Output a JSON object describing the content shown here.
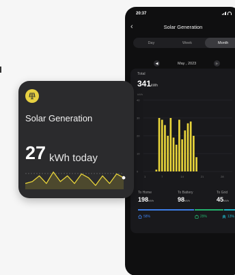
{
  "colors": {
    "accent": "#e8d43a",
    "blue": "#3d7ee8",
    "green": "#23b26d",
    "teal": "#21b6c9"
  },
  "phone": {
    "time": "20:37",
    "title": "Solar Generation",
    "back_icon": "chevron-left-icon",
    "tabs": [
      {
        "label": "Day",
        "active": false
      },
      {
        "label": "Week",
        "active": false
      },
      {
        "label": "Month",
        "active": true
      }
    ],
    "date": "May , 2023",
    "total_label": "Total",
    "total_value": "341",
    "total_unit": "kWh",
    "axis_unit": "kWh",
    "stats": [
      {
        "label": "To Home",
        "value": "198",
        "unit": "kWh"
      },
      {
        "label": "To Battery",
        "value": "98",
        "unit": "kWh"
      },
      {
        "label": "To Grid",
        "value": "45",
        "unit": "kWh"
      }
    ],
    "percents": [
      {
        "icon": "home-icon",
        "value": "58%"
      },
      {
        "icon": "battery-icon",
        "value": "29%"
      },
      {
        "icon": "grid-tower-icon",
        "value": "13%"
      }
    ]
  },
  "chart_data": {
    "type": "bar",
    "yticks": [
      "40",
      "30",
      "20",
      "10",
      "0"
    ],
    "xticks": [
      "1",
      "7",
      "14",
      "21",
      "28"
    ],
    "ylim": [
      0,
      40
    ],
    "x": [
      1,
      2,
      3,
      4,
      5,
      6,
      7,
      8,
      9,
      10,
      11,
      12,
      13,
      14,
      15,
      16,
      17,
      18,
      19,
      20,
      21,
      22,
      23,
      24,
      25,
      26,
      27,
      28,
      29,
      30,
      31
    ],
    "values": [
      0,
      0,
      0,
      0,
      1,
      30,
      29,
      26,
      20,
      30,
      19,
      15,
      29,
      18,
      23,
      27,
      28,
      20,
      8,
      0,
      0,
      0,
      0,
      0,
      0,
      0,
      0,
      0,
      0,
      0,
      0
    ],
    "series_color": "#e8d43a"
  },
  "widget": {
    "icon": "solar-panel-icon",
    "title": "Solar Generation",
    "value": "27",
    "unit": "kWh today",
    "sparkline": [
      3,
      4,
      7,
      3,
      9,
      4,
      7,
      3,
      8,
      6,
      2,
      7,
      3,
      8,
      6
    ],
    "spark_max": 10
  }
}
